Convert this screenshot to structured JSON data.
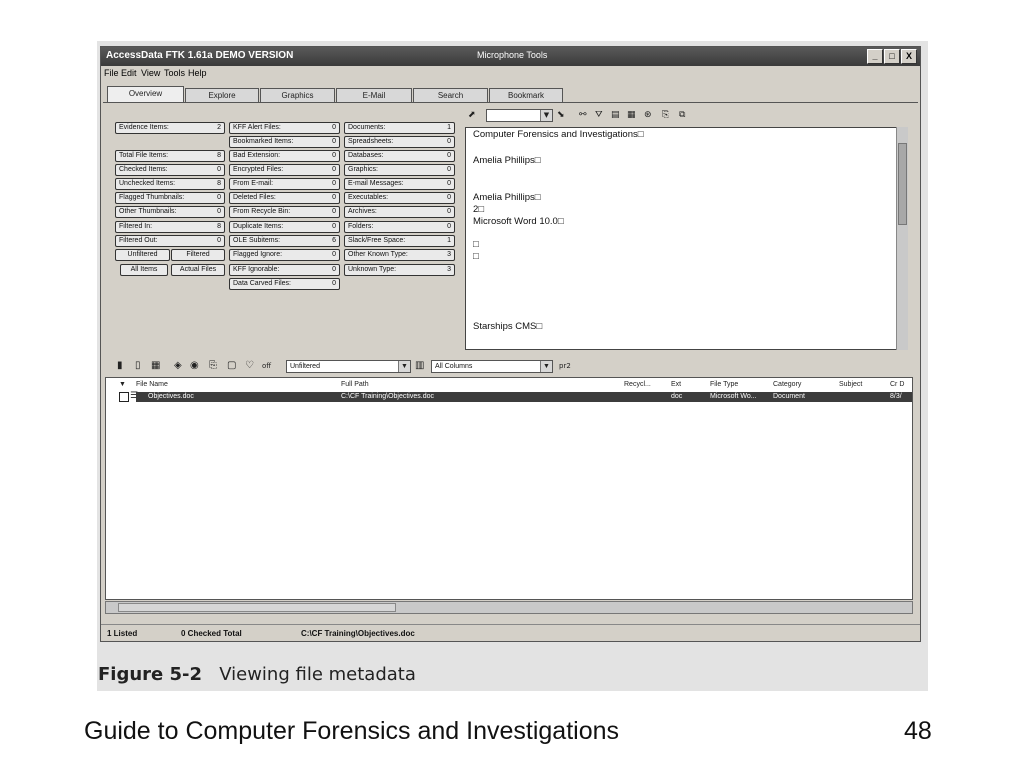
{
  "window": {
    "title": "AccessData FTK 1.61a DEMO VERSION",
    "title_extra": "Microphone   Tools",
    "min": "_",
    "max": "□",
    "close": "X"
  },
  "menu": [
    "File",
    "Edit",
    "View",
    "Tools",
    "Help"
  ],
  "tabs": [
    "Overview",
    "Explore",
    "Graphics",
    "E-Mail",
    "Search",
    "Bookmark"
  ],
  "stats_col1": [
    {
      "label": "Evidence Items:",
      "value": "2"
    },
    {
      "label": "Total File Items:",
      "value": "8"
    },
    {
      "label": "Checked Items:",
      "value": "0"
    },
    {
      "label": "Unchecked Items:",
      "value": "8"
    },
    {
      "label": "Flagged Thumbnails:",
      "value": "0"
    },
    {
      "label": "Other Thumbnails:",
      "value": "0"
    },
    {
      "label": "Filtered In:",
      "value": "8"
    },
    {
      "label": "Filtered Out:",
      "value": "0"
    }
  ],
  "filter_buttons": {
    "unfiltered": "Unfiltered",
    "filtered": "Filtered",
    "all_items": "All Items",
    "actual_files": "Actual Files"
  },
  "stats_col2": [
    {
      "label": "KFF Alert Files:",
      "value": "0"
    },
    {
      "label": "Bookmarked Items:",
      "value": "0"
    },
    {
      "label": "Bad Extension:",
      "value": "0"
    },
    {
      "label": "Encrypted Files:",
      "value": "0"
    },
    {
      "label": "From E-mail:",
      "value": "0"
    },
    {
      "label": "Deleted Files:",
      "value": "0"
    },
    {
      "label": "From Recycle Bin:",
      "value": "0"
    },
    {
      "label": "Duplicate Items:",
      "value": "0"
    },
    {
      "label": "OLE Subitems:",
      "value": "6"
    },
    {
      "label": "Flagged Ignore:",
      "value": "0"
    },
    {
      "label": "KFF Ignorable:",
      "value": "0"
    },
    {
      "label": "Data Carved Files:",
      "value": "0"
    }
  ],
  "stats_col3": [
    {
      "label": "Documents:",
      "value": "1"
    },
    {
      "label": "Spreadsheets:",
      "value": "0"
    },
    {
      "label": "Databases:",
      "value": "0"
    },
    {
      "label": "Graphics:",
      "value": "0"
    },
    {
      "label": "E-mail Messages:",
      "value": "0"
    },
    {
      "label": "Executables:",
      "value": "0"
    },
    {
      "label": "Archives:",
      "value": "0"
    },
    {
      "label": "Folders:",
      "value": "0"
    },
    {
      "label": "Slack/Free Space:",
      "value": "1"
    },
    {
      "label": "Other Known Type:",
      "value": "3"
    },
    {
      "label": "Unknown Type:",
      "value": "3"
    }
  ],
  "viewer_lines": [
    "Computer Forensics and Investigations□",
    "Amelia Phillips□",
    "Amelia Phillips□",
    "2□",
    "Microsoft Word 10.0□",
    "□",
    "□",
    "Starships CMS□"
  ],
  "lower_toolbar": {
    "filter": "Unfiltered",
    "columns": "All Columns",
    "extra": "pr2"
  },
  "list_headers": [
    "File Name",
    "Full Path",
    "Recycl...",
    "Ext",
    "File Type",
    "Category",
    "Subject",
    "Cr D"
  ],
  "list_row": {
    "name": "Objectives.doc",
    "path": "C:\\CF Training\\Objectives.doc",
    "ext": "doc",
    "type": "Microsoft Wo...",
    "category": "Document",
    "date": "8/3/"
  },
  "status": {
    "listed": "1 Listed",
    "checked": "0 Checked Total",
    "path": "C:\\CF Training\\Objectives.doc"
  },
  "caption": {
    "label": "Figure 5-2",
    "text": "Viewing file metadata"
  },
  "footer": {
    "title": "Guide to Computer Forensics and Investigations",
    "page": "48"
  }
}
